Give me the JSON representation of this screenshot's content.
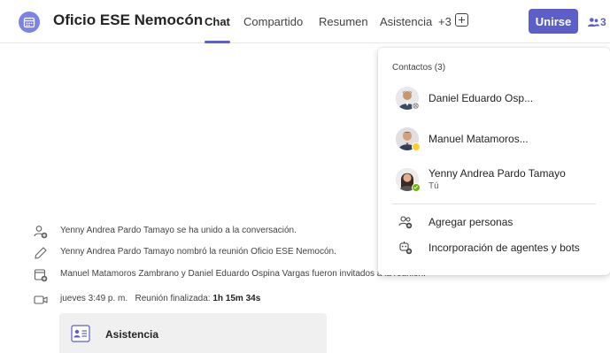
{
  "header": {
    "title": "Oficio ESE Nemocón",
    "tabs": [
      {
        "label": "Chat",
        "active": true
      },
      {
        "label": "Compartido"
      },
      {
        "label": "Resumen"
      },
      {
        "label": "Asistencia"
      },
      {
        "label": "+3"
      }
    ],
    "join_label": "Unirse",
    "people_count": "3",
    "accent_color": "#5b5fc7"
  },
  "feed": {
    "events": [
      {
        "icon": "person-add-icon",
        "text": "Yenny Andrea Pardo Tamayo se ha unido a la conversación."
      },
      {
        "icon": "pencil-icon",
        "text": "Yenny Andrea Pardo Tamayo nombró la reunión Oficio ESE Nemocón."
      },
      {
        "icon": "calendar-add-icon",
        "text": "Manuel Matamoros Zambrano y Daniel Eduardo Ospina Vargas fueron invitados a la reunión."
      }
    ],
    "meeting_end": {
      "icon": "video-camera-icon",
      "time": "jueves 3:49 p. m.",
      "label": "Reunión finalizada:",
      "duration": "1h 15m 34s"
    },
    "attendance_card": {
      "label": "Asistencia"
    }
  },
  "contacts_popover": {
    "header": "Contactos (3)",
    "people": [
      {
        "name": "Daniel Eduardo Osp...",
        "status": "offline"
      },
      {
        "name": "Manuel Matamoros...",
        "status": "away"
      },
      {
        "name": "Yenny Andrea Pardo Tamayo",
        "sub": "Tú",
        "status": "available"
      }
    ],
    "actions": [
      {
        "label": "Agregar personas",
        "icon": "add-people-icon"
      },
      {
        "label": "Incorporación de agentes y bots",
        "icon": "bot-add-icon"
      }
    ],
    "status_colors": {
      "available": "#6bb700",
      "away": "#f8d22a",
      "offline": "#8a8886"
    }
  }
}
